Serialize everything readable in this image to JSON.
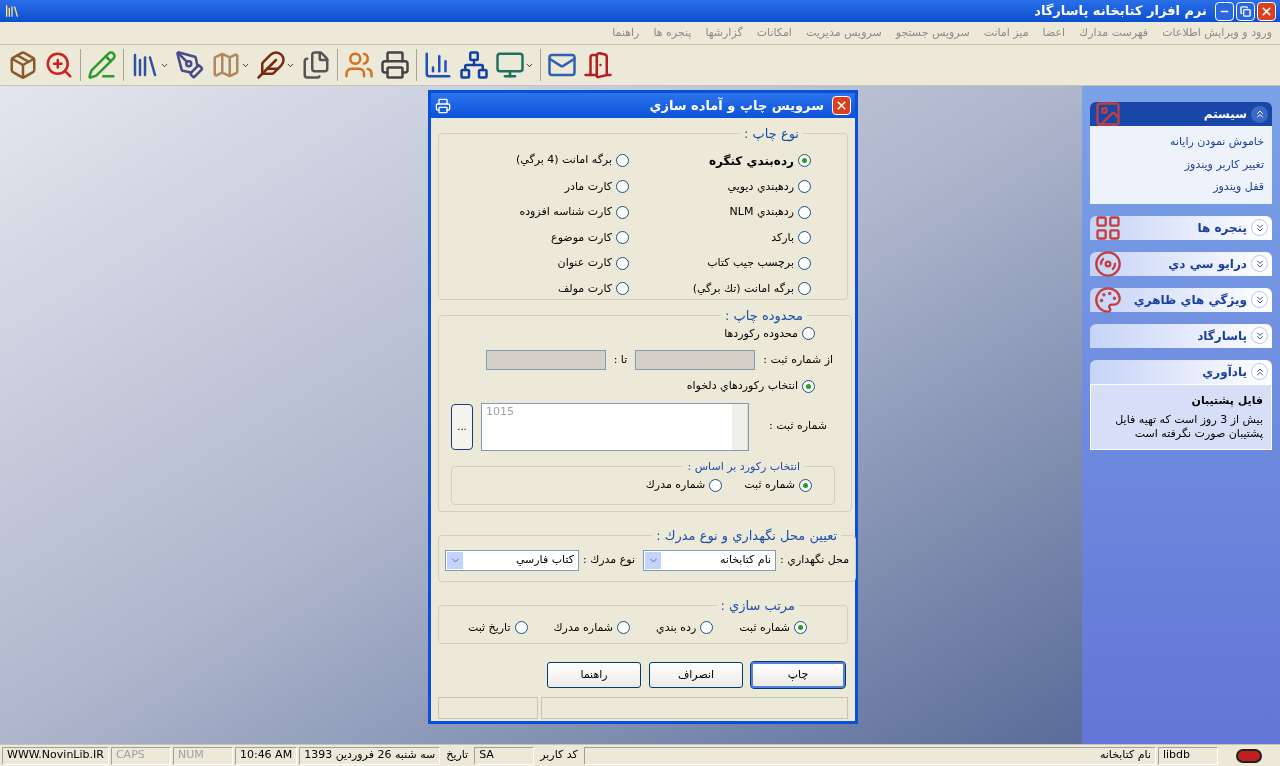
{
  "app": {
    "title": "نرم افزار كتابخانه پاسارگاد"
  },
  "menu": [
    "ورود و ويرايش اطلاعات",
    "فهرست مدارك",
    "اعضا",
    "ميز امانت",
    "سرويس جستجو",
    "سرويس مديريت",
    "امكانات",
    "گزارشها",
    "پنجره ها",
    "راهنما"
  ],
  "dialog": {
    "title": "سرويس چاپ و آماده سازي",
    "print_type": {
      "legend": "نوع چاپ :",
      "options": [
        {
          "label": "رده‌بندي كنگره",
          "selected": true
        },
        {
          "label": "برگه امانت (4 برگي)",
          "selected": false
        },
        {
          "label": "ردهبندي ديويي",
          "selected": false
        },
        {
          "label": "كارت مادر",
          "selected": false
        },
        {
          "label": "ردهبندي NLM",
          "selected": false
        },
        {
          "label": "كارت شناسه افزوده",
          "selected": false
        },
        {
          "label": "باركد",
          "selected": false
        },
        {
          "label": "كارت موضوع",
          "selected": false
        },
        {
          "label": "برچسب جيب كتاب",
          "selected": false
        },
        {
          "label": "كارت عنوان",
          "selected": false
        },
        {
          "label": "برگه امانت (تك برگي)",
          "selected": false
        },
        {
          "label": "كارت مولف",
          "selected": false
        }
      ]
    },
    "range": {
      "legend": "محدوده چاپ :",
      "range_option": {
        "label": "محدوده ركوردها",
        "selected": false
      },
      "from_label": "از شماره ثبت :",
      "to_label": "تا :",
      "custom_option": {
        "label": "انتخاب ركوردهاي دلخواه",
        "selected": true
      },
      "numbers_label": "شماره ثبت :",
      "numbers_value": "1015",
      "browse_button": "...",
      "basis": {
        "legend": "انتخاب ركورد بر اساس :",
        "options": [
          {
            "label": "شماره ثبت",
            "selected": true
          },
          {
            "label": "شماره مدرك",
            "selected": false
          }
        ]
      }
    },
    "location": {
      "legend": "تعيين محل نگهداري و نوع مدرك :",
      "location_label": "محل نگهداري :",
      "location_value": "نام كتابخانه",
      "type_label": "نوع مدرك :",
      "type_value": "كتاب فارسي"
    },
    "sorting": {
      "legend": "مرتب سازي :",
      "options": [
        {
          "label": "شماره ثبت",
          "selected": true
        },
        {
          "label": "رده بندي",
          "selected": false
        },
        {
          "label": "شماره مدرك",
          "selected": false
        },
        {
          "label": "تاريخ ثبت",
          "selected": false
        }
      ]
    },
    "buttons": [
      {
        "label": "چاپ",
        "default": true
      },
      {
        "label": "انصراف",
        "default": false
      },
      {
        "label": "راهنما",
        "default": false
      }
    ]
  },
  "task_panel": [
    {
      "title": "سيستم",
      "expanded": true,
      "links": [
        "خاموش نمودن رايانه",
        "تغيير كاربر ويندوز",
        "قفل ويندوز"
      ]
    },
    {
      "title": "پنجره ها",
      "expanded": false
    },
    {
      "title": "درايو سي دي",
      "expanded": false
    },
    {
      "title": "ويژگي هاي ظاهري",
      "expanded": false
    },
    {
      "title": "پاسارگاد",
      "expanded": false
    },
    {
      "title": "يادآوري",
      "expanded": true,
      "heading": "فايل پشتيبان",
      "text": "بيش از 3 روز است كه تهيه فايل پشتيبان صورت نگرفته است"
    }
  ],
  "status_bar": [
    {
      "kind": "panel",
      "text": "libdb",
      "disabled": false
    },
    {
      "kind": "wide",
      "text": "نام كتابخانه",
      "disabled": false
    },
    {
      "kind": "label",
      "text": "كد كاربر"
    },
    {
      "kind": "panel",
      "text": "SA",
      "disabled": false
    },
    {
      "kind": "label",
      "text": "تاريخ"
    },
    {
      "kind": "panel",
      "text": "سه شنبه  26  فروردين  1393",
      "disabled": false
    },
    {
      "kind": "panel",
      "text": "10:46 AM",
      "disabled": false
    },
    {
      "kind": "panel",
      "text": "NUM",
      "disabled": true
    },
    {
      "kind": "panel",
      "text": "CAPS",
      "disabled": true
    },
    {
      "kind": "panel",
      "text": "WWW.NovinLib.IR",
      "disabled": false
    }
  ]
}
